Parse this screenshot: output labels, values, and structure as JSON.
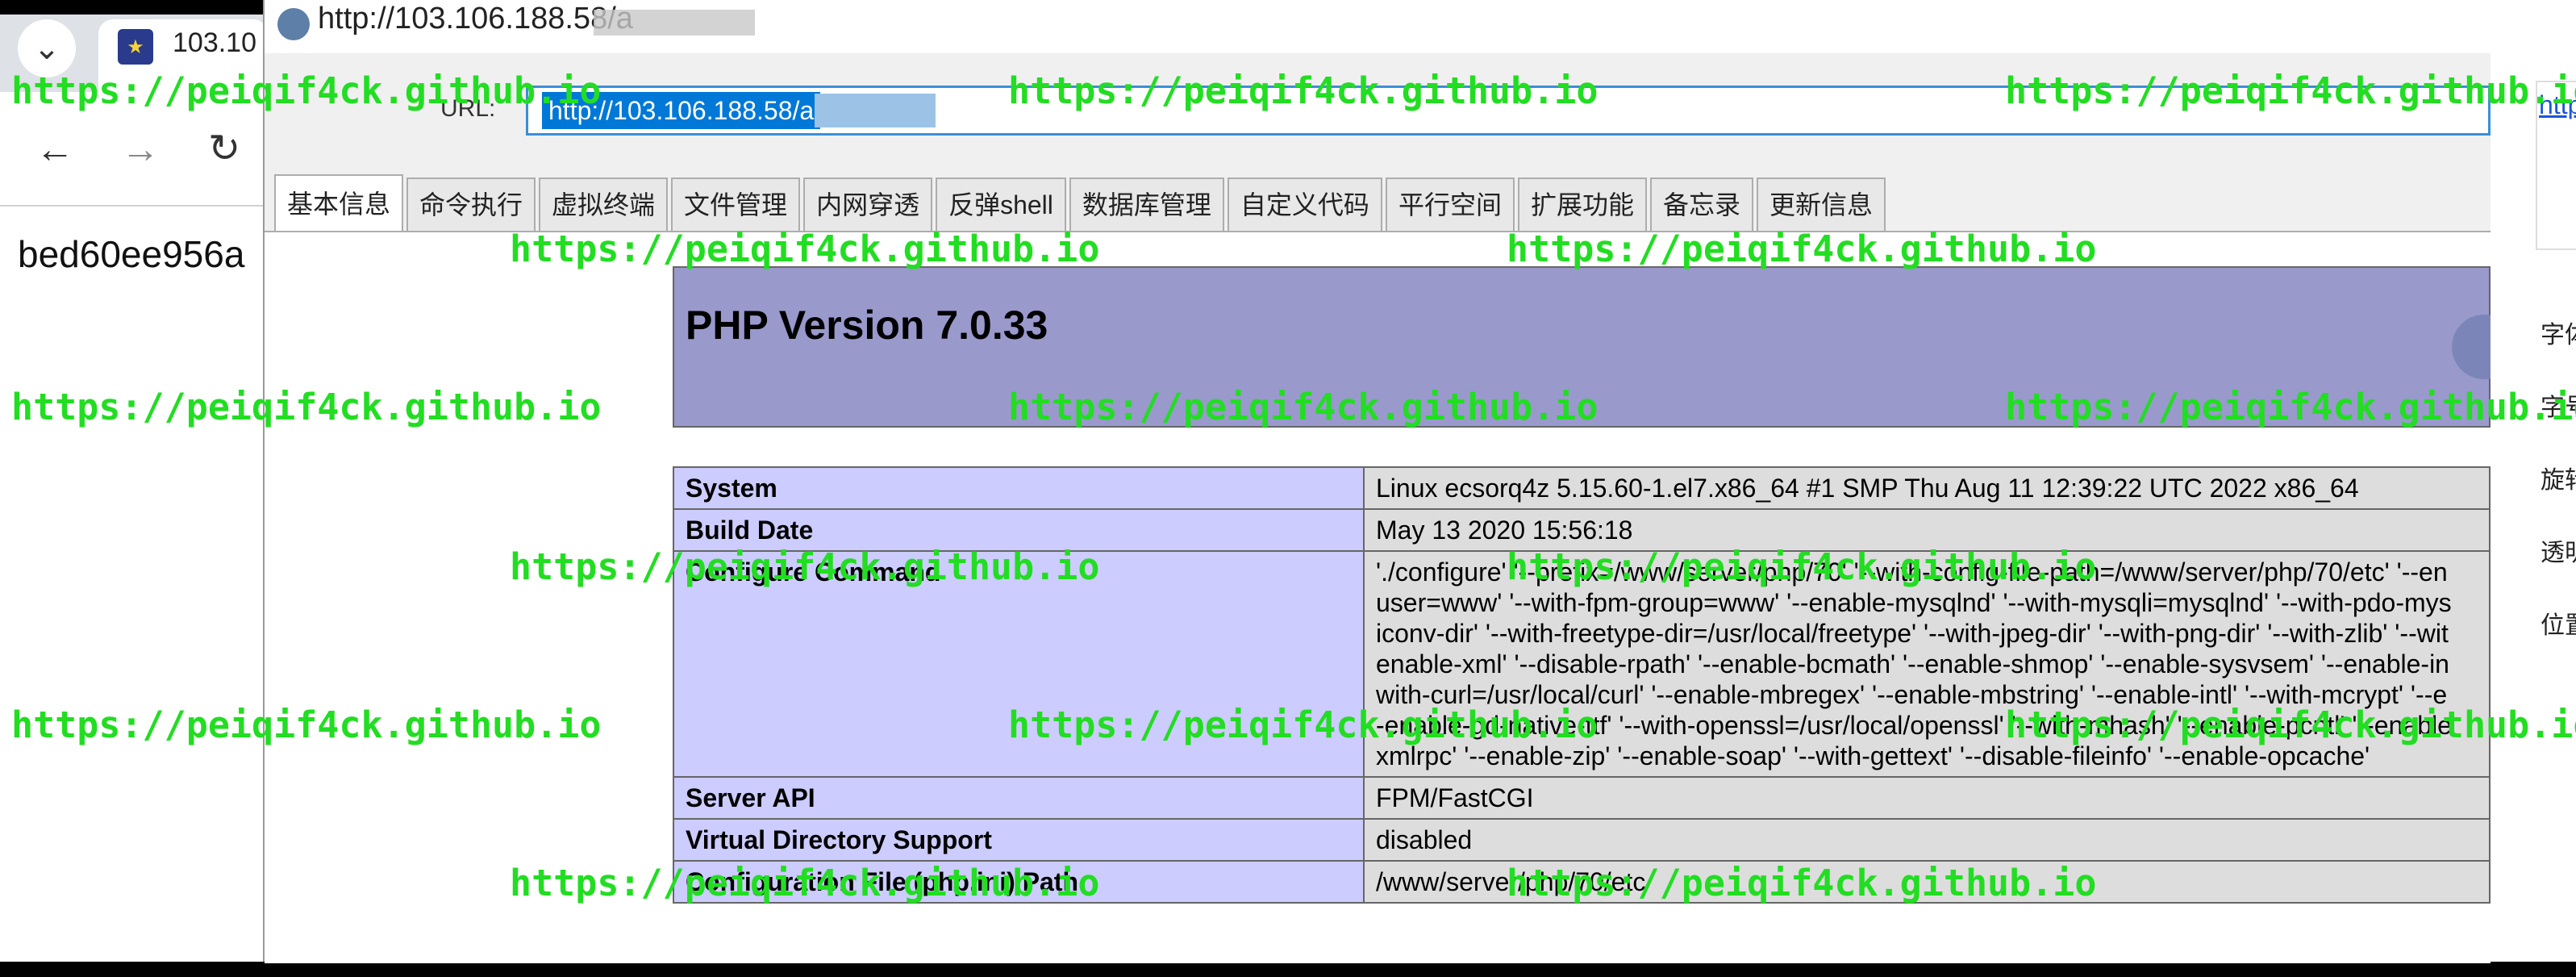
{
  "browser": {
    "tab_title": "103.10",
    "page_text": "bed60ee956a",
    "icons": {
      "dropdown": "chevron-down-icon",
      "back": "arrow-left-icon",
      "forward": "arrow-right-icon",
      "reload": "reload-icon"
    }
  },
  "window": {
    "title": "http://103.106.188.58/a"
  },
  "url_bar": {
    "label": "URL:",
    "value": "http://103.106.188.58/a"
  },
  "tabs": [
    {
      "label": "基本信息",
      "active": true
    },
    {
      "label": "命令执行"
    },
    {
      "label": "虚拟终端"
    },
    {
      "label": "文件管理"
    },
    {
      "label": "内网穿透"
    },
    {
      "label": "反弹shell"
    },
    {
      "label": "数据库管理"
    },
    {
      "label": "自定义代码"
    },
    {
      "label": "平行空间"
    },
    {
      "label": "扩展功能"
    },
    {
      "label": "备忘录"
    },
    {
      "label": "更新信息"
    }
  ],
  "phpinfo": {
    "title": "PHP Version 7.0.33",
    "header_color": "#9999cc",
    "key_color": "#ccccff",
    "value_color": "#dddddd",
    "rows": [
      {
        "key": "System",
        "value": "Linux ecsorq4z 5.15.60-1.el7.x86_64 #1 SMP Thu Aug 11 12:39:22 UTC 2022 x86_64"
      },
      {
        "key": "Build Date",
        "value": "May 13 2020 15:56:18"
      },
      {
        "key": "Server API",
        "value": "FPM/FastCGI"
      },
      {
        "key": "Virtual Directory Support",
        "value": "disabled"
      },
      {
        "key": "Configuration File (php.ini) Path",
        "value": "/www/server/php/70/etc"
      }
    ],
    "configure": {
      "key": "Configure Command",
      "lines": [
        "'./configure' '--prefix=/www/server/php/70' '--with-config-file-path=/www/server/php/70/etc' '--en",
        "user=www' '--with-fpm-group=www' '--enable-mysqlnd' '--with-mysqli=mysqlnd' '--with-pdo-mys",
        "iconv-dir' '--with-freetype-dir=/usr/local/freetype' '--with-jpeg-dir' '--with-png-dir' '--with-zlib' '--wit",
        "enable-xml' '--disable-rpath' '--enable-bcmath' '--enable-shmop' '--enable-sysvsem' '--enable-in",
        "with-curl=/usr/local/curl' '--enable-mbregex' '--enable-mbstring' '--enable-intl' '--with-mcrypt' '--e",
        "-enable-gd-native-ttf' '--with-openssl=/usr/local/openssl' '--with-mhash' '--enable-pcntl' '--enable",
        "xmlrpc' '--enable-zip' '--enable-soap' '--with-gettext' '--disable-fileinfo' '--enable-opcache'"
      ]
    }
  },
  "right_panel": {
    "link": "http",
    "labels": [
      "字体",
      "字号",
      "旋转",
      "透明",
      "位置"
    ]
  },
  "watermark": {
    "text": "https://peiqif4ck.github.io",
    "color": "#22dd22"
  }
}
